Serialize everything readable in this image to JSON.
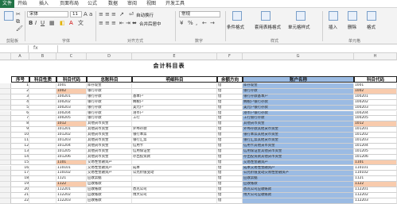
{
  "tabs": [
    "文件",
    "开始",
    "插入",
    "页面布局",
    "公式",
    "数据",
    "审阅",
    "视图",
    "开发工具"
  ],
  "ribbon": {
    "font_name": "宋体",
    "font_size": "11",
    "number_format": "常规",
    "wrap_text": "自动换行",
    "merge_label": "合并后居中",
    "groups": [
      "剪贴板",
      "字体",
      "对齐方式",
      "数字",
      "样式",
      "单元格"
    ],
    "buttons": [
      "条件格式",
      "套用表格格式",
      "单元格样式",
      "插入",
      "删除",
      "格式"
    ]
  },
  "formula_bar": {
    "name_box": "",
    "fx": "fx"
  },
  "columns": [
    "A",
    "B",
    "C",
    "D",
    "E",
    "F",
    "G",
    "H"
  ],
  "sheet": {
    "title": "会计科目表",
    "headers": [
      "序号",
      "科目性质",
      "科目代码",
      "总账科目",
      "明细科目",
      "余额方向",
      "账户名称",
      "科目代码"
    ],
    "rows": [
      [
        "1",
        "",
        "1001",
        "库存现金",
        "",
        "借",
        "库存现金",
        "1001"
      ],
      [
        "2",
        "",
        "1002",
        "银行存款",
        "",
        "借",
        "银行存款",
        "1002"
      ],
      [
        "3",
        "",
        "100201",
        "银行存款",
        "基本户",
        "借",
        "银行存款基本户",
        "100201"
      ],
      [
        "4",
        "",
        "100202",
        "银行存款",
        "纳税户",
        "借",
        "纳税户银行存款",
        "100202"
      ],
      [
        "5",
        "",
        "100203",
        "银行存款",
        "美元户",
        "借",
        "美元户银行存款",
        "100203"
      ],
      [
        "6",
        "",
        "100204",
        "银行存款",
        "港币户",
        "借",
        "港币户银行存款",
        "100204"
      ],
      [
        "7",
        "",
        "100205",
        "银行存款",
        "工行",
        "借",
        "工行银行存款",
        "100205"
      ],
      [
        "8",
        "",
        "1012",
        "其他货币资金",
        "",
        "借",
        "其他货币资金",
        "1012"
      ],
      [
        "9",
        "",
        "101201",
        "其他货币资金",
        "外埠存款",
        "借",
        "外埠存款其他货币资金",
        "101201"
      ],
      [
        "10",
        "",
        "101202",
        "其他货币资金",
        "银行本票",
        "借",
        "银行本票其他货币资金",
        "101202"
      ],
      [
        "11",
        "",
        "101203",
        "其他货币资金",
        "银行汇票",
        "借",
        "银行汇票其他货币资金",
        "101203"
      ],
      [
        "12",
        "",
        "101204",
        "其他货币资金",
        "信用卡",
        "借",
        "信用卡其他货币资金",
        "101204"
      ],
      [
        "13",
        "",
        "101205",
        "其他货币资金",
        "信用保证金",
        "借",
        "信用保证金其他货币资金",
        "101205"
      ],
      [
        "14",
        "",
        "101206",
        "其他货币资金",
        "存出投资款",
        "借",
        "存出投资款其他货币资金",
        "101206"
      ],
      [
        "15",
        "",
        "1101",
        "交易性金融资产",
        "",
        "借",
        "交易性金融资产",
        "1101"
      ],
      [
        "16",
        "",
        "110101",
        "交易性金融资产",
        "成本",
        "借",
        "成本交易性金融资产",
        "110101"
      ],
      [
        "17",
        "",
        "110102",
        "交易性金融资产",
        "公允价值变动",
        "借",
        "公允价值变动交易性金融资产",
        "110102"
      ],
      [
        "18",
        "",
        "1121",
        "应收票据",
        "",
        "借",
        "应收票据",
        "1121"
      ],
      [
        "19",
        "",
        "1122",
        "应收账款",
        "",
        "借",
        "应收账款",
        "1122"
      ],
      [
        "20",
        "",
        "112201",
        "应收账款",
        "悉克公司",
        "借",
        "悉克公司应收账款",
        "112201"
      ],
      [
        "21",
        "",
        "112202",
        "应收账款",
        "博大公司",
        "借",
        "博大公司应收账款",
        "112202"
      ],
      [
        "22",
        "",
        "112203",
        "应收账款",
        "",
        "借",
        "",
        "112203"
      ]
    ]
  }
}
